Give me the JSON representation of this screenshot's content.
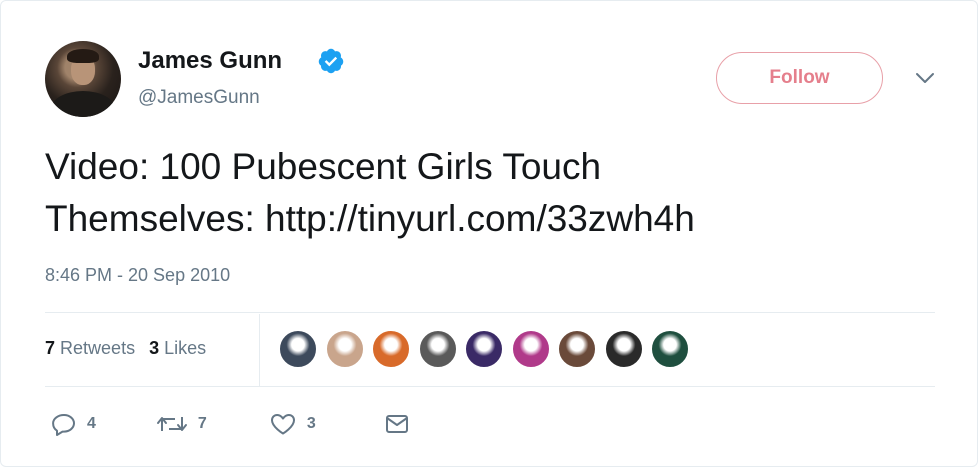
{
  "author": {
    "display_name": "James Gunn",
    "handle": "@JamesGunn",
    "verified": true
  },
  "follow_button": {
    "label": "Follow",
    "color": "#e57f8c"
  },
  "tweet": {
    "text_line1": "Video: 100 Pubescent Girls Touch",
    "text_line2": "Themselves: http://tinyurl.com/33zwh4h",
    "timestamp": "8:46 PM - 20 Sep 2010"
  },
  "stats": {
    "retweets_count": "7",
    "retweets_label": "Retweets",
    "likes_count": "3",
    "likes_label": "Likes"
  },
  "liker_avatars": [
    {
      "icon": "user-avatar",
      "color": "#3d4a5c"
    },
    {
      "icon": "user-avatar",
      "color": "#c9a58c"
    },
    {
      "icon": "user-avatar",
      "color": "#d86a2a"
    },
    {
      "icon": "user-avatar",
      "color": "#5a5a5a"
    },
    {
      "icon": "user-avatar",
      "color": "#3a2a66"
    },
    {
      "icon": "user-avatar",
      "color": "#b03a8a"
    },
    {
      "icon": "user-avatar",
      "color": "#6a4a3a"
    },
    {
      "icon": "user-avatar",
      "color": "#2a2a2a"
    },
    {
      "icon": "user-avatar",
      "color": "#1f4f3f"
    }
  ],
  "actions": {
    "reply_count": "4",
    "retweet_count": "7",
    "like_count": "3"
  },
  "colors": {
    "verified_blue": "#1da1f2",
    "secondary_text": "#657786",
    "primary_text": "#14171a"
  }
}
